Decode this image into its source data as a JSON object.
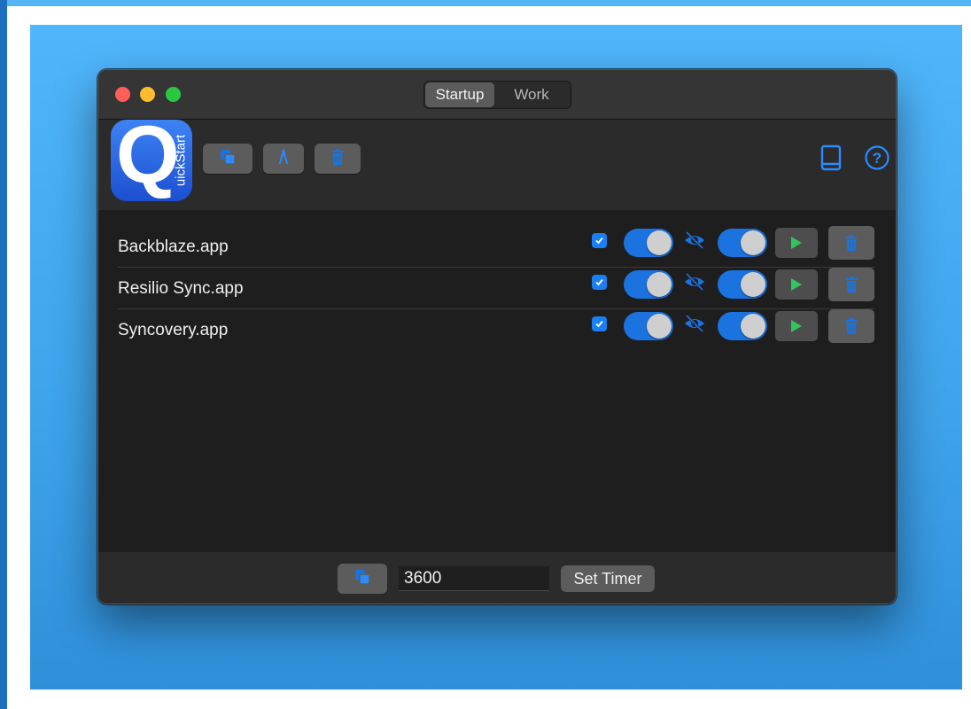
{
  "window": {
    "tabs": [
      {
        "label": "Startup",
        "selected": true
      },
      {
        "label": "Work",
        "selected": false
      }
    ]
  },
  "toolbar": {
    "app_icon": {
      "letter": "Q",
      "word": "uickStart"
    },
    "icons": [
      "duplicate-icon",
      "edit-icon",
      "trash-icon",
      "book-icon",
      "help-icon"
    ]
  },
  "list": {
    "items": [
      {
        "label": "Backblaze.app",
        "checked": true,
        "launch_enabled": true,
        "hidden": true,
        "active": true
      },
      {
        "label": "Resilio Sync.app",
        "checked": true,
        "launch_enabled": true,
        "hidden": true,
        "active": true
      },
      {
        "label": "Syncovery.app",
        "checked": true,
        "launch_enabled": true,
        "hidden": true,
        "active": true
      }
    ]
  },
  "footer": {
    "timer_value": "3600",
    "set_timer_label": "Set Timer"
  },
  "colors": {
    "accent": "#1b73df",
    "play": "#31c55b",
    "desktop": "#4aaef5"
  }
}
